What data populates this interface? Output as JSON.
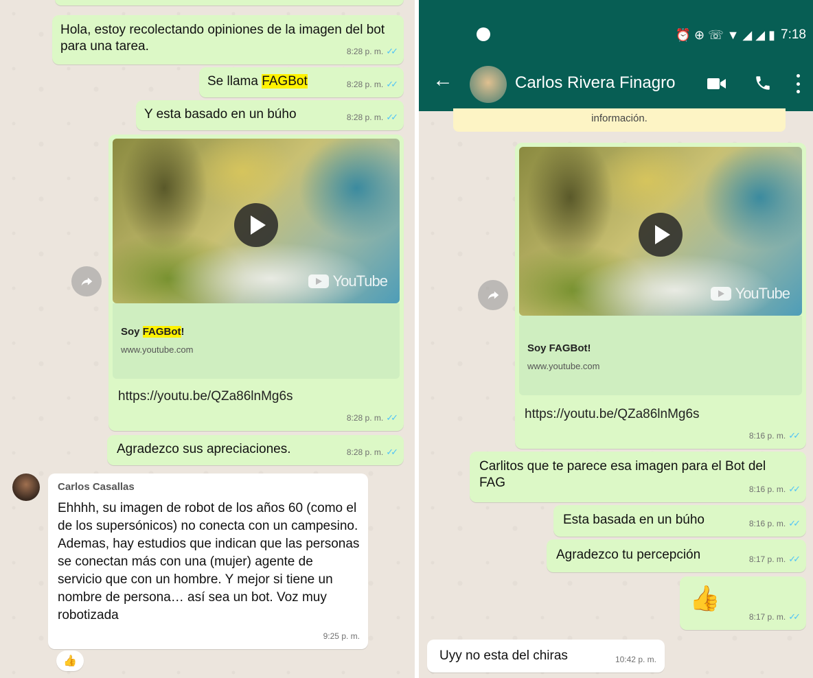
{
  "left": {
    "messages": [
      {
        "text": "Hola, estoy recolectando opiniones de la imagen del bot para una tarea.",
        "time": "8:28 p. m."
      },
      {
        "text_before": "Se llama ",
        "highlight": "FAGBot",
        "time": "8:28 p. m."
      },
      {
        "text": "Y esta basado en un búho",
        "time": "8:28 p. m."
      },
      {
        "link_title_highlight": "FAGBot",
        "link_title_prefix": "Soy ",
        "link_title_suffix": "!",
        "link_domain": "www.youtube.com",
        "url": "https://youtu.be/QZa86lnMg6s",
        "time": "8:28 p. m.",
        "yt_label": "YouTube"
      },
      {
        "text": "Agradezco sus apreciaciones.",
        "time": "8:28 p. m."
      }
    ],
    "reply": {
      "sender": "Carlos Casallas",
      "text": "Ehhhh, su imagen de robot de los años 60 (como el de los supersónicos) no conecta con un campesino. Ademas, hay estudios que indican que las personas se conectan más con una (mujer) agente de servicio que con un hombre. Y mejor si tiene un nombre de persona… así sea un bot. Voz muy robotizada",
      "time": "9:25 p. m.",
      "reaction": "👍"
    }
  },
  "right": {
    "status": {
      "time": "7:18",
      "icons": "⏰ ⊕ ☏ ▼ ◢ ◢ ▮"
    },
    "header": {
      "contact": "Carlos Rivera Finagro"
    },
    "banner": "información.",
    "messages": [
      {
        "link_title": "Soy FAGBot!",
        "link_domain": "www.youtube.com",
        "url": "https://youtu.be/QZa86lnMg6s",
        "time": "8:16 p. m.",
        "yt_label": "YouTube"
      },
      {
        "text": "Carlitos que te parece esa imagen para el Bot del FAG",
        "time": "8:16 p. m."
      },
      {
        "text": "Esta basada en un búho",
        "time": "8:16 p. m."
      },
      {
        "text": "Agradezco tu percepción",
        "time": "8:17 p. m."
      },
      {
        "emoji": "👍",
        "time": "8:17 p. m."
      },
      {
        "text": "Uyy no esta del chiras",
        "time": "10:42 p. m."
      }
    ]
  },
  "colors": {
    "header": "#075e54",
    "outgoing": "#dcf8c6",
    "incoming": "#ffffff",
    "ticks": "#4fc3f7",
    "highlight": "#fff200"
  }
}
